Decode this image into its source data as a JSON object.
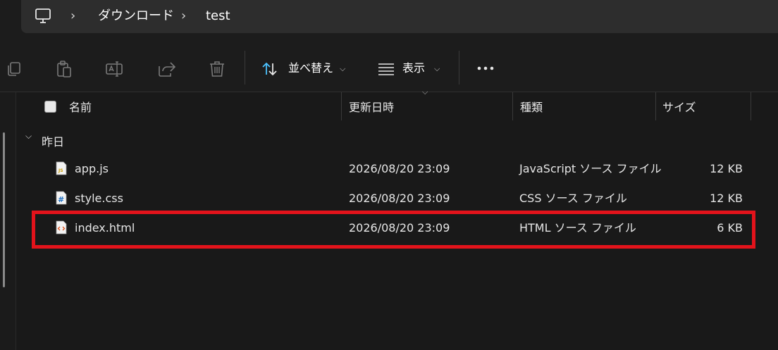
{
  "breadcrumb": {
    "items": [
      "ダウンロード",
      "test"
    ]
  },
  "toolbar": {
    "sort_label": "並べ替え",
    "view_label": "表示"
  },
  "columns": {
    "name": "名前",
    "date": "更新日時",
    "type": "種類",
    "size": "サイズ"
  },
  "group": {
    "label": "昨日"
  },
  "files": [
    {
      "name": "app.js",
      "date": "2026/08/20 23:09",
      "type": "JavaScript ソース ファイル",
      "size": "12 KB",
      "icon": "js-file-icon"
    },
    {
      "name": "style.css",
      "date": "2026/08/20 23:09",
      "type": "CSS ソース ファイル",
      "size": "12 KB",
      "icon": "css-file-icon"
    },
    {
      "name": "index.html",
      "date": "2026/08/20 23:09",
      "type": "HTML ソース ファイル",
      "size": "6 KB",
      "icon": "html-file-icon"
    }
  ],
  "colors": {
    "highlight": "#e3131b",
    "accent": "#4cc2ff"
  }
}
